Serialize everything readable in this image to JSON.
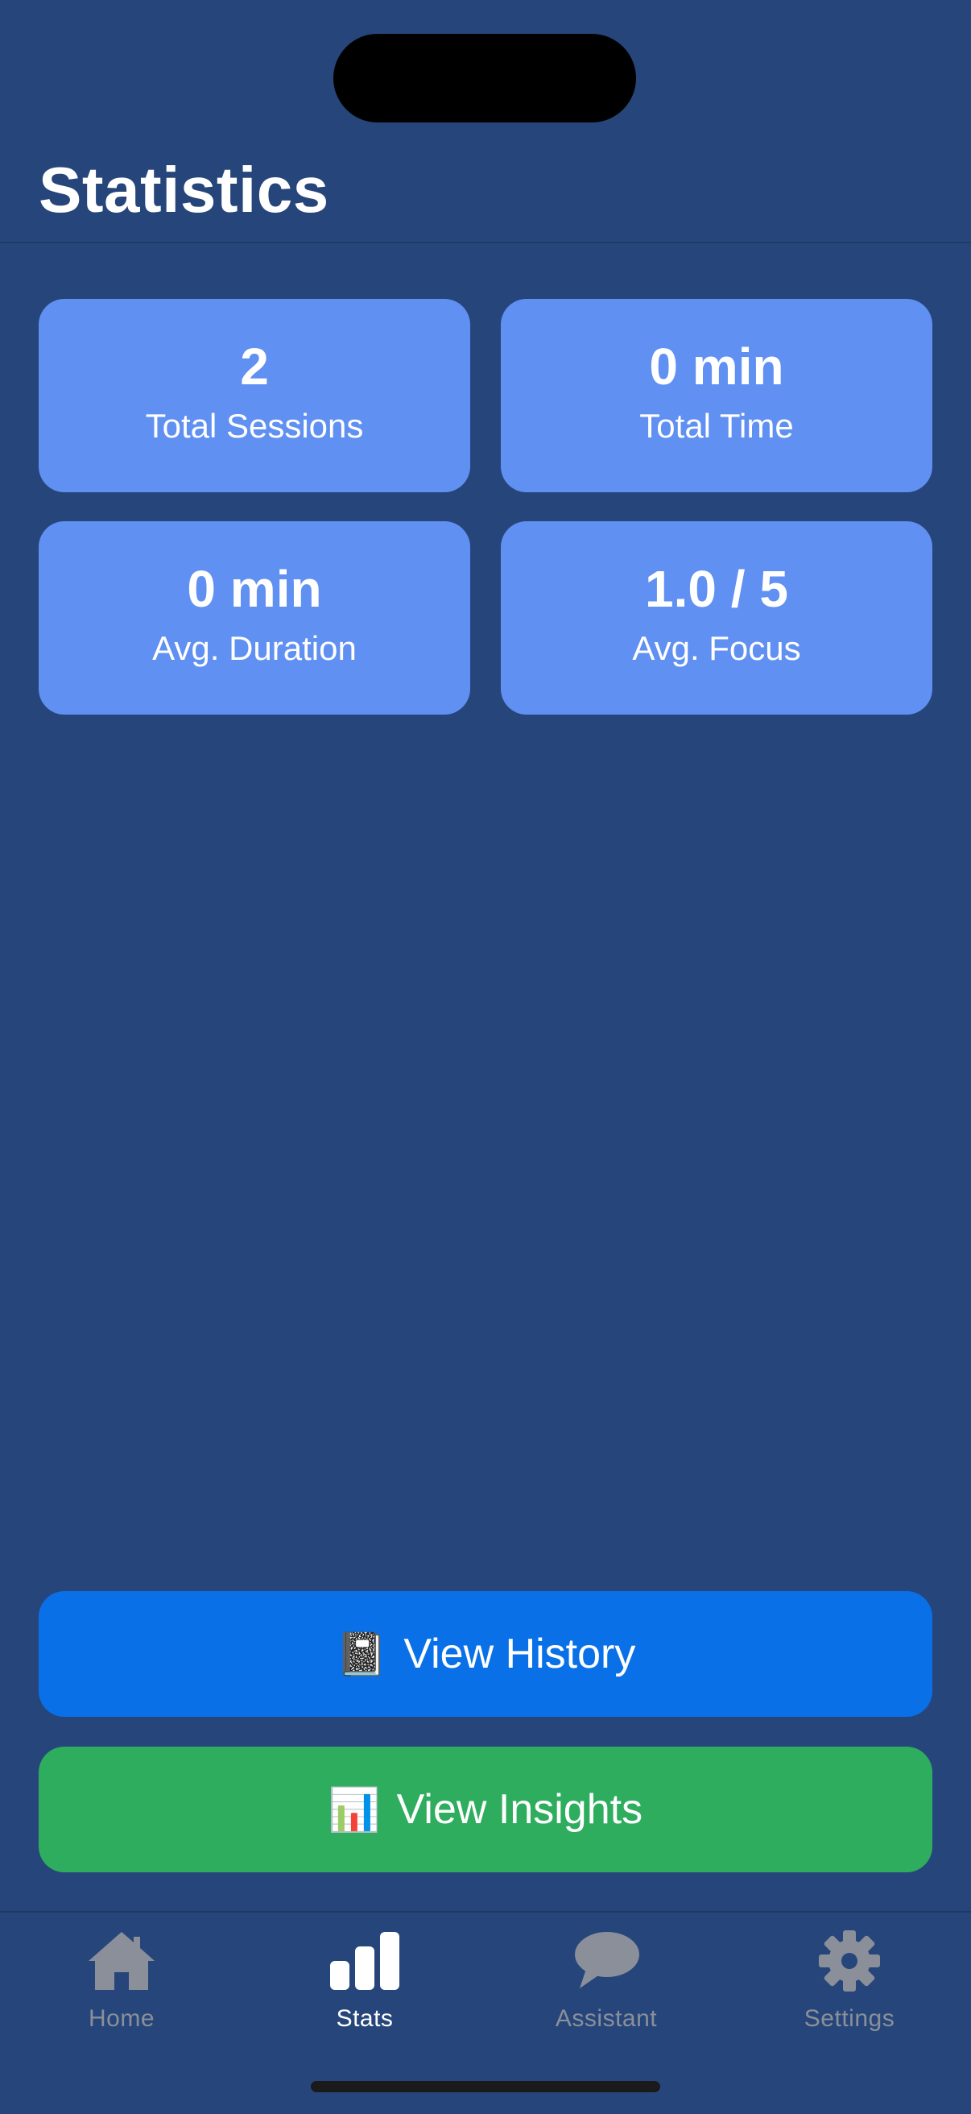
{
  "header": {
    "title": "Statistics"
  },
  "stats": [
    {
      "value": "2",
      "label": "Total Sessions"
    },
    {
      "value": "0 min",
      "label": "Total Time"
    },
    {
      "value": "0 min",
      "label": "Avg. Duration"
    },
    {
      "value": "1.0 / 5",
      "label": "Avg. Focus"
    }
  ],
  "actions": {
    "history": {
      "icon": "📓",
      "label": "View History",
      "icon_name": "notebook-icon",
      "color": "#0a70e8"
    },
    "insights": {
      "icon": "📊",
      "label": "View Insights",
      "icon_name": "bar-chart-icon",
      "color": "#2fad5e"
    }
  },
  "tabbar": {
    "items": [
      {
        "label": "Home",
        "icon": "house-icon",
        "active": false
      },
      {
        "label": "Stats",
        "icon": "stats-bars-icon",
        "active": true
      },
      {
        "label": "Assistant",
        "icon": "chat-bubble-icon",
        "active": false
      },
      {
        "label": "Settings",
        "icon": "gear-icon",
        "active": false
      }
    ]
  },
  "colors": {
    "background": "#26467b",
    "card": "#6090f2",
    "tab_active": "#ffffff",
    "tab_inactive": "#8a8f99"
  }
}
